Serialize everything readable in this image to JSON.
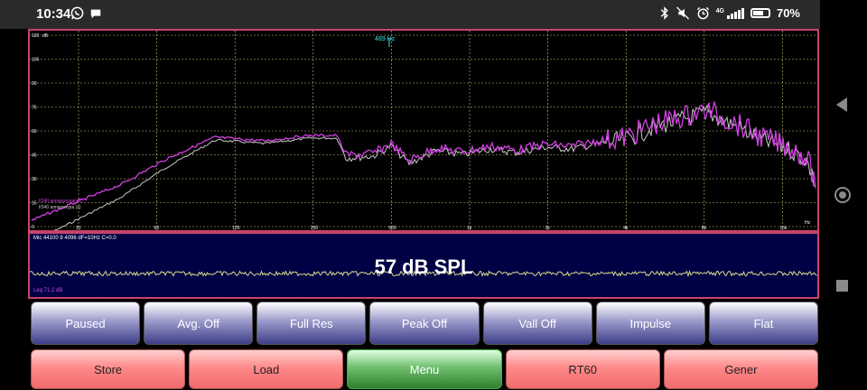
{
  "statusbar": {
    "time": "10:34",
    "network": "4G",
    "battery": "70%",
    "battery_level": 0.7
  },
  "spectrum": {
    "y_label": "dB",
    "y_ticks": [
      "120",
      "105",
      "90",
      "75",
      "60",
      "45",
      "30",
      "15",
      "0"
    ],
    "x_ticks": [
      "31",
      "63",
      "125",
      "250",
      "500",
      "1k",
      "2k",
      "4k",
      "8k",
      "16k"
    ],
    "x_unit": "Hz",
    "cursor_label": "489 Hz",
    "legend_magenta": "f/340 аппаратура(dB)",
    "legend_white": "f/340 аппаратура (s)"
  },
  "spl_panel": {
    "info": "Mic 44100 8 4096 dF=10Hz C=0.0",
    "value": "57 dB SPL",
    "leq": "Leq 71.2 dB"
  },
  "buttons_row1": [
    "Paused",
    "Avg. Off",
    "Full Res",
    "Peak Off",
    "Vall Off",
    "Impulse",
    "Flat"
  ],
  "buttons_row2": [
    "Store",
    "Load",
    "Menu",
    "RT60",
    "Gener"
  ],
  "colors": {
    "grid": "#c8c870",
    "panel_border": "#c8426c",
    "trace_magenta": "#d040e0",
    "trace_white": "#c8c8c8",
    "spl_wave": "#d8d890",
    "cursor": "#40e0e0"
  }
}
